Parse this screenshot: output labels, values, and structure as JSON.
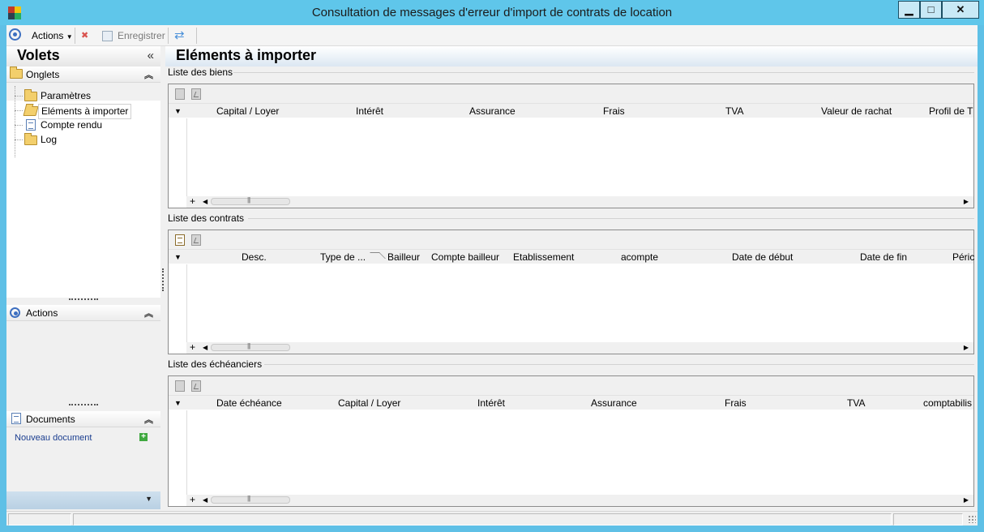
{
  "window": {
    "title": "Consultation de messages d'erreur d'import de contrats de location",
    "minimize": "▁",
    "maximize": "□",
    "close": "✕"
  },
  "toolbar": {
    "actions_label": "Actions",
    "save_label": "Enregistrer"
  },
  "panes": {
    "title": "Volets",
    "collapse_icon": "«",
    "onglets": {
      "label": "Onglets",
      "items": [
        {
          "label": "Paramètres",
          "icon": "folder-icon"
        },
        {
          "label": "Eléments à importer",
          "icon": "folder-open-icon",
          "selected": true
        },
        {
          "label": "Compte rendu",
          "icon": "document-icon"
        },
        {
          "label": "Log",
          "icon": "folder-icon"
        }
      ]
    },
    "actions": {
      "label": "Actions"
    },
    "documents": {
      "label": "Documents",
      "new_document": "Nouveau document"
    }
  },
  "content": {
    "title": "Eléments à importer",
    "grids": [
      {
        "label": "Liste des biens",
        "columns": [
          "Capital / Loyer",
          "Intérêt",
          "Assurance",
          "Frais",
          "TVA",
          "Valeur de rachat",
          "Profil de T"
        ]
      },
      {
        "label": "Liste des contrats",
        "columns": [
          "Desc.",
          "Type de ...",
          "Bailleur",
          "Compte bailleur",
          "Etablissement",
          "acompte",
          "Date de début",
          "Date de fin",
          "Péric"
        ]
      },
      {
        "label": "Liste des échéanciers",
        "columns": [
          "Date échéance",
          "Capital / Loyer",
          "Intérêt",
          "Assurance",
          "Frais",
          "TVA",
          "comptabilis"
        ]
      }
    ]
  },
  "colors": {
    "titlebar": "#5fc6ea",
    "accent": "#3d6fc0",
    "link": "#1a3d8f"
  }
}
